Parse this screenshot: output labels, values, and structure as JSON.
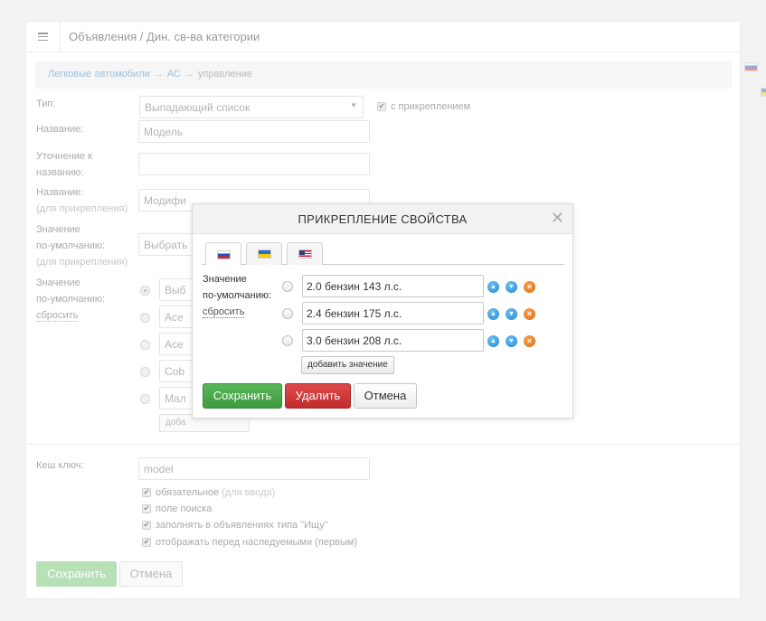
{
  "header": {
    "title": "Объявления / Дин. св-ва категории"
  },
  "breadcrumb": {
    "item1": "Легковые автомобили",
    "item2": "АС",
    "item3": "управление",
    "separator": "→"
  },
  "form": {
    "type_label": "Тип:",
    "type_value": "Выпадающий список",
    "attach_checkbox": "с прикреплением",
    "name_label": "Название:",
    "name_value": "Модель",
    "clarify_label_1": "Уточнение к",
    "clarify_label_2": "названию:",
    "name_attach_label": "Название:",
    "name_attach_sub": "(для прикрепления)",
    "name_attach_value": "Модифи",
    "default_attach_label_1": "Значение",
    "default_attach_label_2": "по-умолчанию:",
    "default_attach_sub": "(для прикрепления)",
    "default_attach_value": "Выбрать",
    "default_label_1": "Значение",
    "default_label_2": "по-умолчанию:",
    "default_reset": "сбросить",
    "values": [
      "Выб",
      "Ace",
      "Ace",
      "Cob",
      "Mал"
    ],
    "add_value_partial": "доба",
    "cache_label": "Кеш ключ:",
    "cache_value": "model",
    "required_label": "обязательное",
    "required_sub": "(для ввода)",
    "search_label": "поле поиска",
    "fill_label": "заполнять в объявлениях типа \"Ищу\"",
    "display_label": "отображать перед наследуемыми (первым)",
    "check_mark": "✔",
    "select_arrow": "▼",
    "save_label": "Сохранить",
    "cancel_label": "Отмена"
  },
  "modal": {
    "title": "ПРИКРЕПЛЕНИЕ СВОЙСТВА",
    "close_glyph": "✕",
    "default_label_1": "Значение",
    "default_label_2": "по-умолчанию:",
    "reset_link": "сбросить",
    "values": [
      "2.0 бензин 143 л.с.",
      "2.4 бензин 175 л.с.",
      "3.0 бензин 208 л.с."
    ],
    "up_glyph": "▲",
    "down_glyph": "▼",
    "delete_glyph": "×",
    "add_value_label": "добавить значение",
    "save_label": "Сохранить",
    "delete_label": "Удалить",
    "cancel_label": "Отмена"
  },
  "icons": {
    "menu": "hamburger-icon",
    "close": "close-icon",
    "up": "arrow-up-icon",
    "down": "arrow-down-icon",
    "delete": "delete-icon"
  },
  "colors": {
    "save": "#4cae4c",
    "delete": "#d03737",
    "icon_blue": "#1f86cf",
    "icon_orange": "#dd6a0d"
  }
}
